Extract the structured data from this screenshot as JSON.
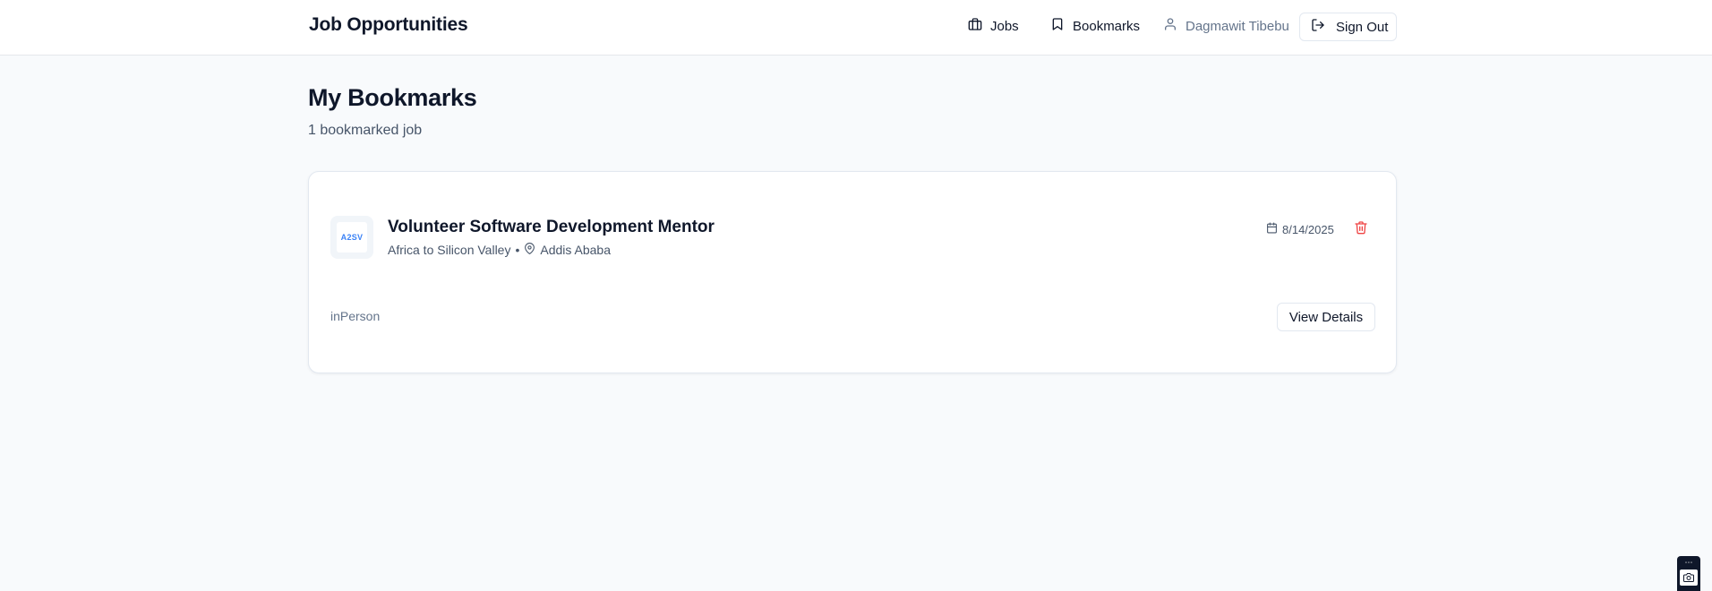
{
  "header": {
    "brand": "Job Opportunities",
    "nav": {
      "jobs": "Jobs",
      "bookmarks": "Bookmarks",
      "user": "Dagmawit Tibebu"
    },
    "sign_out": "Sign Out"
  },
  "main": {
    "title": "My Bookmarks",
    "subtitle": "1 bookmarked job",
    "bookmarks": [
      {
        "logo_text": "A2SV",
        "title": "Volunteer Software Development Mentor",
        "company": "Africa to Silicon Valley",
        "separator": "•",
        "location": "Addis Ababa",
        "date": "8/14/2025",
        "work_type": "inPerson",
        "view_label": "View Details"
      }
    ]
  },
  "colors": {
    "accent_red": "#ef4444",
    "text_primary": "#0f172a",
    "text_muted": "#64748b",
    "background": "#f8fafc"
  },
  "icons": {
    "jobs": "briefcase-icon",
    "bookmarks": "bookmark-icon",
    "user": "user-icon",
    "sign_out": "log-out-icon",
    "location": "map-pin-icon",
    "date": "calendar-icon",
    "remove": "trash-icon"
  }
}
